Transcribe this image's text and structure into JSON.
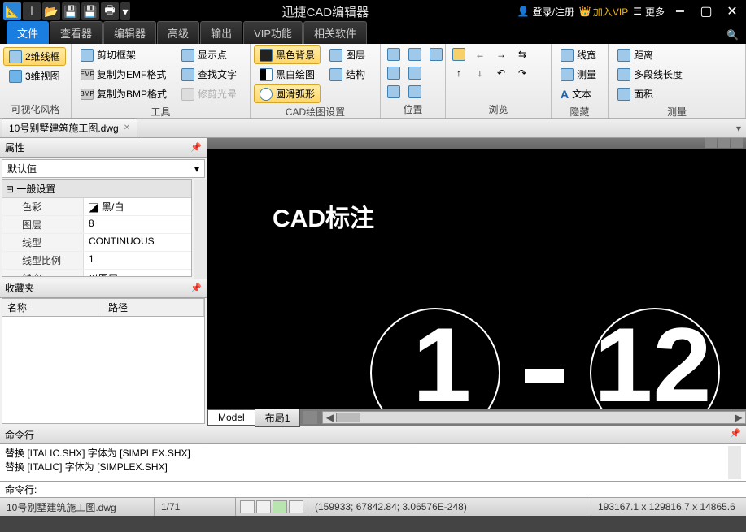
{
  "title": "迅捷CAD编辑器",
  "top": {
    "login": "登录/注册",
    "vip": "加入VIP",
    "more": "更多"
  },
  "tabs": [
    "文件",
    "查看器",
    "编辑器",
    "高级",
    "输出",
    "VIP功能",
    "相关软件"
  ],
  "ribbon": {
    "g1": {
      "label": "可视化风格",
      "b1": "2维线框",
      "b2": "3维视图"
    },
    "g2": {
      "label": "工具",
      "b1": "剪切框架",
      "b2": "复制为EMF格式",
      "b3": "复制为BMP格式",
      "c1": "显示点",
      "c2": "查找文字",
      "c3": "修剪光晕"
    },
    "g3": {
      "label": "CAD绘图设置",
      "b1": "黑色背景",
      "b2": "黑白绘图",
      "b3": "圆滑弧形",
      "c1": "图层",
      "c2": "结构"
    },
    "g4": {
      "label": "位置"
    },
    "g5": {
      "label": "浏览"
    },
    "g6": {
      "label": "隐藏",
      "b1": "线宽",
      "b2": "测量",
      "b3": "文本"
    },
    "g7": {
      "label": "测量",
      "b1": "距离",
      "b2": "多段线长度",
      "b3": "面积"
    }
  },
  "doc_tab": "10号别墅建筑施工图.dwg",
  "props": {
    "title": "属性",
    "default": "默认值",
    "section": "一般设置",
    "rows": [
      {
        "k": "色彩",
        "v": "黑/白",
        "swatch": true
      },
      {
        "k": "图层",
        "v": "8"
      },
      {
        "k": "线型",
        "v": "CONTINUOUS"
      },
      {
        "k": "线型比例",
        "v": "1"
      },
      {
        "k": "线宽",
        "v": "以图层"
      }
    ]
  },
  "fav": {
    "title": "收藏夹",
    "col1": "名称",
    "col2": "路径"
  },
  "canvas": {
    "label": "CAD标注",
    "tabs": [
      "Model",
      "布局1"
    ]
  },
  "cmd": {
    "title": "命令行",
    "lines": [
      "替换 [ITALIC.SHX] 字体为 [SIMPLEX.SHX]",
      "替换 [ITALIC] 字体为 [SIMPLEX.SHX]"
    ],
    "prompt": "命令行:"
  },
  "status": {
    "file": "10号别墅建筑施工图.dwg",
    "page": "1/71",
    "coords": "(159933; 67842.84; 3.06576E-248)",
    "extent": "193167.1 x 129816.7 x 14865.6"
  }
}
